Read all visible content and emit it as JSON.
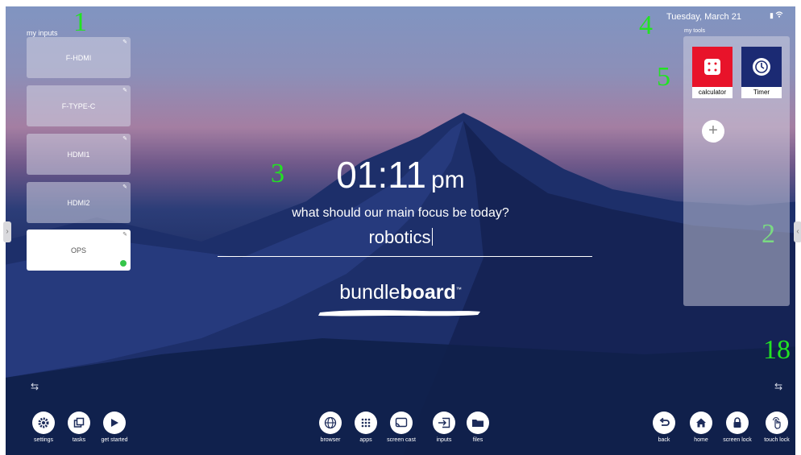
{
  "annotations": [
    "1",
    "2",
    "3",
    "4",
    "5",
    "18"
  ],
  "inputs": {
    "title": "my inputs",
    "items": [
      {
        "label": "F-HDMI"
      },
      {
        "label": "F-TYPE-C"
      },
      {
        "label": "HDMI1"
      },
      {
        "label": "HDMI2"
      },
      {
        "label": "OPS"
      }
    ]
  },
  "header": {
    "date": "Tuesday, March 21"
  },
  "tools": {
    "title": "my tools",
    "items": [
      {
        "label": "calculator",
        "icon": "calculator-icon",
        "color": "#e8132a"
      },
      {
        "label": "Timer",
        "icon": "timer-icon",
        "color": "#1b2a73"
      }
    ],
    "add_icon": "plus-icon"
  },
  "clock": {
    "time": "01:11",
    "ampm": "pm"
  },
  "focus": {
    "question": "what should our main focus be today?",
    "answer": "robotics"
  },
  "brand": {
    "light": "bundle",
    "bold": "board",
    "tm": "™"
  },
  "dock": {
    "left": [
      {
        "label": "settings",
        "icon": "gear-icon"
      },
      {
        "label": "tasks",
        "icon": "tasks-icon"
      },
      {
        "label": "get started",
        "icon": "play-icon"
      }
    ],
    "center": [
      {
        "label": "browser",
        "icon": "globe-icon"
      },
      {
        "label": "apps",
        "icon": "apps-grid-icon"
      },
      {
        "label": "screen cast",
        "icon": "screen-cast-icon"
      },
      {
        "label": "inputs",
        "icon": "input-icon"
      },
      {
        "label": "files",
        "icon": "folder-icon"
      }
    ],
    "right": [
      {
        "label": "back",
        "icon": "back-icon"
      },
      {
        "label": "home",
        "icon": "home-icon"
      },
      {
        "label": "screen lock",
        "icon": "lock-icon"
      },
      {
        "label": "touch lock",
        "icon": "touch-lock-icon"
      }
    ]
  }
}
